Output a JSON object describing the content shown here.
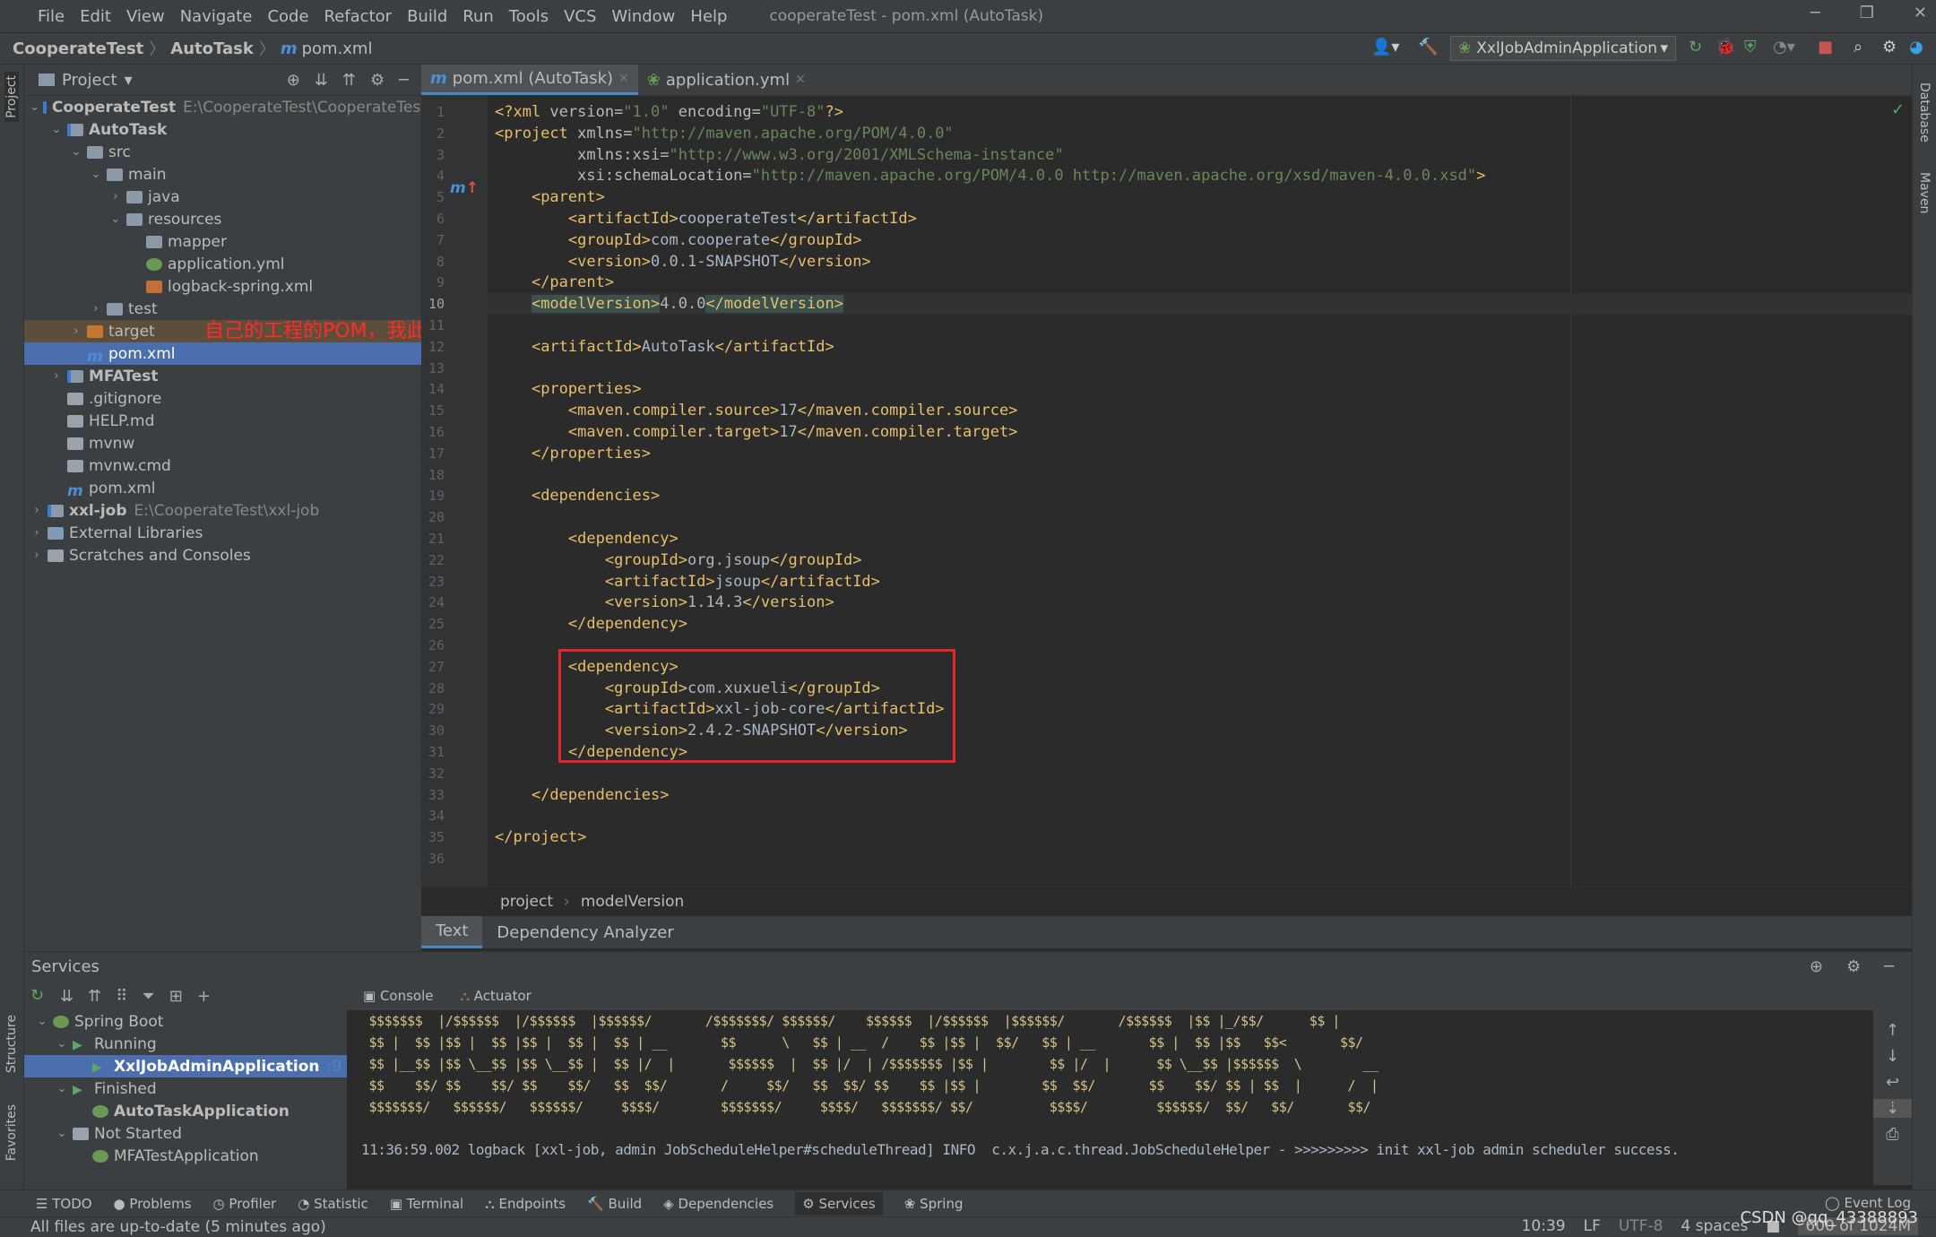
{
  "menu": {
    "items": [
      "File",
      "Edit",
      "View",
      "Navigate",
      "Code",
      "Refactor",
      "Build",
      "Run",
      "Tools",
      "VCS",
      "Window",
      "Help"
    ],
    "title": "cooperateTest - pom.xml (AutoTask)"
  },
  "nav": {
    "crumbs": [
      "CooperateTest",
      "AutoTask",
      "pom.xml"
    ]
  },
  "toolbar": {
    "run_config": "XxlJobAdminApplication"
  },
  "project": {
    "header": "Project",
    "tree": [
      {
        "lvl": 0,
        "arr": "⌄",
        "ic": "mod",
        "label": "CooperateTest",
        "bold": true,
        "hint": "E:\\CooperateTest\\CooperateTest"
      },
      {
        "lvl": 1,
        "arr": "⌄",
        "ic": "mod",
        "label": "AutoTask",
        "bold": true
      },
      {
        "lvl": 2,
        "arr": "⌄",
        "ic": "folder",
        "label": "src"
      },
      {
        "lvl": 3,
        "arr": "⌄",
        "ic": "folder",
        "label": "main"
      },
      {
        "lvl": 4,
        "arr": "›",
        "ic": "folder",
        "label": "java"
      },
      {
        "lvl": 4,
        "arr": "⌄",
        "ic": "folder",
        "label": "resources"
      },
      {
        "lvl": 5,
        "arr": "",
        "ic": "folder",
        "label": "mapper"
      },
      {
        "lvl": 5,
        "arr": "",
        "ic": "yml",
        "label": "application.yml"
      },
      {
        "lvl": 5,
        "arr": "",
        "ic": "xml",
        "label": "logback-spring.xml"
      },
      {
        "lvl": 3,
        "arr": "›",
        "ic": "folder",
        "label": "test"
      },
      {
        "lvl": 2,
        "arr": "›",
        "ic": "orange",
        "label": "target",
        "state": "tgt"
      },
      {
        "lvl": 2,
        "arr": "",
        "ic": "m",
        "label": "pom.xml",
        "state": "sel"
      },
      {
        "lvl": 1,
        "arr": "›",
        "ic": "mod",
        "label": "MFATest",
        "bold": true
      },
      {
        "lvl": 1,
        "arr": "",
        "ic": "file",
        "label": ".gitignore"
      },
      {
        "lvl": 1,
        "arr": "",
        "ic": "file",
        "label": "HELP.md"
      },
      {
        "lvl": 1,
        "arr": "",
        "ic": "file",
        "label": "mvnw"
      },
      {
        "lvl": 1,
        "arr": "",
        "ic": "file",
        "label": "mvnw.cmd"
      },
      {
        "lvl": 1,
        "arr": "",
        "ic": "m",
        "label": "pom.xml"
      },
      {
        "lvl": 0,
        "arr": "›",
        "ic": "mod",
        "label": "xxl-job",
        "bold": true,
        "hint": "E:\\CooperateTest\\xxl-job"
      },
      {
        "lvl": 0,
        "arr": "›",
        "ic": "lib",
        "label": "External Libraries"
      },
      {
        "lvl": 0,
        "arr": "›",
        "ic": "file",
        "label": "Scratches and Consoles"
      }
    ]
  },
  "annotation": "自己的工程的POM，我此时的是AutoTask",
  "editor": {
    "tabs": [
      {
        "label": "pom.xml (AutoTask)",
        "active": true
      },
      {
        "label": "application.yml"
      }
    ],
    "current_line": 10,
    "lines": [
      [
        [
          "tg",
          "<?xml "
        ],
        [
          "at",
          "version="
        ],
        [
          "va",
          "\"1.0\" "
        ],
        [
          "at",
          "encoding="
        ],
        [
          "va",
          "\"UTF-8\""
        ],
        [
          "tg",
          "?>"
        ]
      ],
      [
        [
          "tg",
          "<project "
        ],
        [
          "at",
          "xmlns="
        ],
        [
          "va",
          "\"http://maven.apache.org/POM/4.0.0\""
        ]
      ],
      [
        [
          "tx",
          "         "
        ],
        [
          "at",
          "xmlns:xsi="
        ],
        [
          "va",
          "\"http://www.w3.org/2001/XMLSchema-instance\""
        ]
      ],
      [
        [
          "tx",
          "         "
        ],
        [
          "at",
          "xsi:schemaLocation="
        ],
        [
          "va",
          "\"http://maven.apache.org/POM/4.0.0 http://maven.apache.org/xsd/maven-4.0.0.xsd\""
        ],
        [
          "tg",
          ">"
        ]
      ],
      [
        [
          "tx",
          "    "
        ],
        [
          "tg",
          "<parent>"
        ]
      ],
      [
        [
          "tx",
          "        "
        ],
        [
          "tg",
          "<artifactId>"
        ],
        [
          "tx",
          "cooperateTest"
        ],
        [
          "tg",
          "</artifactId>"
        ]
      ],
      [
        [
          "tx",
          "        "
        ],
        [
          "tg",
          "<groupId>"
        ],
        [
          "tx",
          "com.cooperate"
        ],
        [
          "tg",
          "</groupId>"
        ]
      ],
      [
        [
          "tx",
          "        "
        ],
        [
          "tg",
          "<version>"
        ],
        [
          "tx",
          "0.0.1-SNAPSHOT"
        ],
        [
          "tg",
          "</version>"
        ]
      ],
      [
        [
          "tx",
          "    "
        ],
        [
          "tg",
          "</parent>"
        ]
      ],
      [
        [
          "tx",
          "    "
        ],
        [
          "tg hl",
          "<modelVersion>"
        ],
        [
          "tx",
          "4.0.0"
        ],
        [
          "tg hl",
          "</modelVersion>"
        ]
      ],
      [],
      [
        [
          "tx",
          "    "
        ],
        [
          "tg",
          "<artifactId>"
        ],
        [
          "tx",
          "AutoTask"
        ],
        [
          "tg",
          "</artifactId>"
        ]
      ],
      [],
      [
        [
          "tx",
          "    "
        ],
        [
          "tg",
          "<properties>"
        ]
      ],
      [
        [
          "tx",
          "        "
        ],
        [
          "tg",
          "<maven.compiler.source>"
        ],
        [
          "tx",
          "17"
        ],
        [
          "tg",
          "</maven.compiler.source>"
        ]
      ],
      [
        [
          "tx",
          "        "
        ],
        [
          "tg",
          "<maven.compiler.target>"
        ],
        [
          "tx",
          "17"
        ],
        [
          "tg",
          "</maven.compiler.target>"
        ]
      ],
      [
        [
          "tx",
          "    "
        ],
        [
          "tg",
          "</properties>"
        ]
      ],
      [],
      [
        [
          "tx",
          "    "
        ],
        [
          "tg",
          "<dependencies>"
        ]
      ],
      [],
      [
        [
          "tx",
          "        "
        ],
        [
          "tg",
          "<dependency>"
        ]
      ],
      [
        [
          "tx",
          "            "
        ],
        [
          "tg",
          "<groupId>"
        ],
        [
          "tx",
          "org.jsoup"
        ],
        [
          "tg",
          "</groupId>"
        ]
      ],
      [
        [
          "tx",
          "            "
        ],
        [
          "tg",
          "<artifactId>"
        ],
        [
          "tx",
          "jsoup"
        ],
        [
          "tg",
          "</artifactId>"
        ]
      ],
      [
        [
          "tx",
          "            "
        ],
        [
          "tg",
          "<version>"
        ],
        [
          "tx",
          "1.14.3"
        ],
        [
          "tg",
          "</version>"
        ]
      ],
      [
        [
          "tx",
          "        "
        ],
        [
          "tg",
          "</dependency>"
        ]
      ],
      [],
      [
        [
          "tx",
          "        "
        ],
        [
          "tg",
          "<dependency>"
        ]
      ],
      [
        [
          "tx",
          "            "
        ],
        [
          "tg",
          "<groupId>"
        ],
        [
          "tx",
          "com.xuxueli"
        ],
        [
          "tg",
          "</groupId>"
        ]
      ],
      [
        [
          "tx",
          "            "
        ],
        [
          "tg",
          "<artifactId>"
        ],
        [
          "tx",
          "xxl-job-core"
        ],
        [
          "tg",
          "</artifactId>"
        ]
      ],
      [
        [
          "tx",
          "            "
        ],
        [
          "tg",
          "<version>"
        ],
        [
          "tx",
          "2.4.2-SNAPSHOT"
        ],
        [
          "tg",
          "</version>"
        ]
      ],
      [
        [
          "tx",
          "        "
        ],
        [
          "tg",
          "</dependency>"
        ]
      ],
      [],
      [
        [
          "tx",
          "    "
        ],
        [
          "tg",
          "</dependencies>"
        ]
      ],
      [],
      [
        [
          "tg",
          "</project>"
        ]
      ],
      []
    ],
    "breadcrumb": [
      "project",
      "modelVersion"
    ],
    "bottom_tabs": [
      "Text",
      "Dependency Analyzer"
    ]
  },
  "services": {
    "title": "Services",
    "tree": [
      {
        "lvl": 0,
        "arr": "⌄",
        "ic": "yml",
        "label": "Spring Boot"
      },
      {
        "lvl": 1,
        "arr": "⌄",
        "ic": "run",
        "label": "Running"
      },
      {
        "lvl": 2,
        "arr": "",
        "ic": "run",
        "label": "XxlJobAdminApplication",
        "bold": true,
        "hint": ":9",
        "state": "sel"
      },
      {
        "lvl": 1,
        "arr": "⌄",
        "ic": "run",
        "label": "Finished"
      },
      {
        "lvl": 2,
        "arr": "",
        "ic": "yml",
        "label": "AutoTaskApplication",
        "bold": true
      },
      {
        "lvl": 1,
        "arr": "⌄",
        "ic": "file",
        "label": "Not Started"
      },
      {
        "lvl": 2,
        "arr": "",
        "ic": "yml",
        "label": "MFATestApplication"
      }
    ],
    "console_tabs": [
      "Console",
      "Actuator"
    ],
    "console_art": [
      " $$$$$$$  |/$$$$$$  |/$$$$$$  |$$$$$$/       /$$$$$$$/ $$$$$$/    $$$$$$  |/$$$$$$  |$$$$$$/       /$$$$$$  |$$ |_/$$/      $$ |",
      " $$ |  $$ |$$ |  $$ |$$ |  $$ |  $$ | __       $$      \\   $$ | __  /    $$ |$$ |  $$/   $$ | __       $$ |  $$ |$$   $$<       $$/",
      " $$ |__$$ |$$ \\__$$ |$$ \\__$$ |  $$ |/  |       $$$$$$  |  $$ |/  | /$$$$$$$ |$$ |        $$ |/  |      $$ \\__$$ |$$$$$$  \\        __",
      " $$    $$/ $$    $$/ $$    $$/   $$  $$/       /     $$/   $$  $$/ $$    $$ |$$ |        $$  $$/       $$    $$/ $$ | $$  |      /  |",
      " $$$$$$$/   $$$$$$/   $$$$$$/     $$$$/        $$$$$$$/     $$$$/   $$$$$$$/ $$/          $$$$/         $$$$$$/  $$/   $$/       $$/"
    ],
    "log_line": "11:36:59.002 logback [xxl-job, admin JobScheduleHelper#scheduleThread] INFO  c.x.j.a.c.thread.JobScheduleHelper - >>>>>>>>> init xxl-job admin scheduler success."
  },
  "toolwindows": {
    "bottom": [
      "TODO",
      "Problems",
      "Profiler",
      "Statistic",
      "Terminal",
      "Endpoints",
      "Build",
      "Dependencies",
      "Services",
      "Spring"
    ],
    "active": "Services",
    "event_log": "Event Log",
    "left": [
      "Project",
      "Structure",
      "Favorites"
    ],
    "right": [
      "Database",
      "Maven"
    ]
  },
  "status": {
    "message": "All files are up-to-date (5 minutes ago)",
    "position": "10:39",
    "line_sep": "LF",
    "encoding": "UTF-8",
    "indent": "4 spaces",
    "memory": "600 of 1024M"
  },
  "watermark": "CSDN @qq_43388893"
}
